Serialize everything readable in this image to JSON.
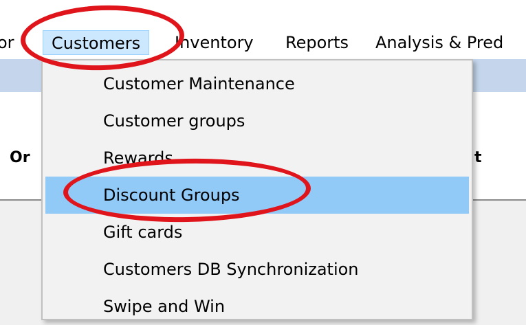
{
  "menubar": {
    "items": [
      {
        "label": "or"
      },
      {
        "label": "Customers"
      },
      {
        "label": "Inventory"
      },
      {
        "label": "Reports"
      },
      {
        "label": "Analysis & Pred"
      }
    ]
  },
  "content": {
    "headers": [
      "Or",
      "t"
    ]
  },
  "customers_menu": {
    "items": [
      {
        "label": "Customer Maintenance"
      },
      {
        "label": "Customer groups"
      },
      {
        "label": "Rewards"
      },
      {
        "label": "Discount Groups"
      },
      {
        "label": "Gift cards"
      },
      {
        "label": "Customers DB Synchronization"
      },
      {
        "label": "Swipe and Win"
      }
    ],
    "highlighted": "Discount Groups"
  },
  "colors": {
    "highlight": "#91c9f7",
    "active_menu": "#cce8ff",
    "annotation": "#e0141b"
  }
}
